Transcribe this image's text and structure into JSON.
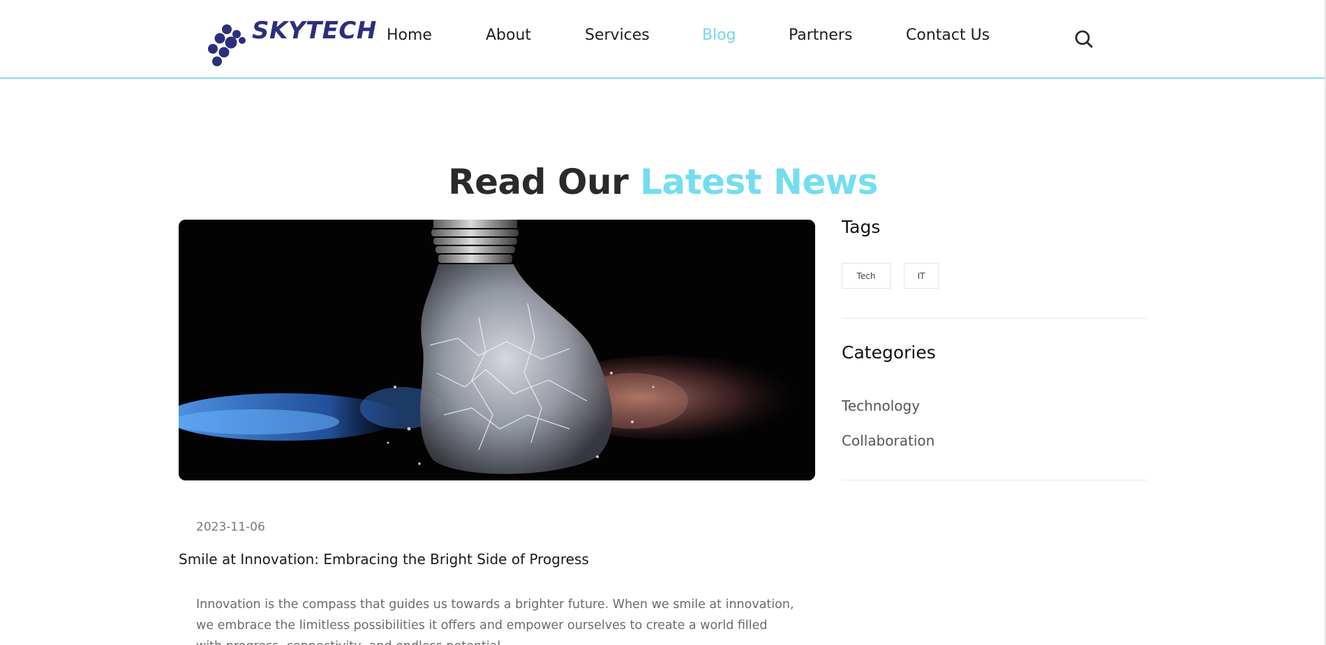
{
  "brand": {
    "name": "SKYTECH",
    "logo_color": "#2b2f7e",
    "accent_color": "#74ddf0"
  },
  "nav": {
    "items": [
      {
        "label": "Home"
      },
      {
        "label": "About"
      },
      {
        "label": "Services"
      },
      {
        "label": "Blog",
        "active": true
      },
      {
        "label": "Partners"
      },
      {
        "label": "Contact Us"
      }
    ],
    "search_icon": "search-icon"
  },
  "heading": {
    "part1": "Read Our",
    "part2": "Latest News"
  },
  "post": {
    "image": "exploding-light-bulb",
    "date": "2023-11-06",
    "title": "Smile at Innovation: Embracing the Bright Side of Progress",
    "excerpt": "Innovation is the compass that guides us towards a brighter future. When we smile at innovation, we embrace the limitless possibilities it offers and empower ourselves to create a world filled with progress, connectivity, and endless potential."
  },
  "sidebar": {
    "tags_title": "Tags",
    "tags": [
      "Tech",
      "IT"
    ],
    "categories_title": "Categories",
    "categories": [
      "Technology",
      "Collaboration"
    ]
  }
}
